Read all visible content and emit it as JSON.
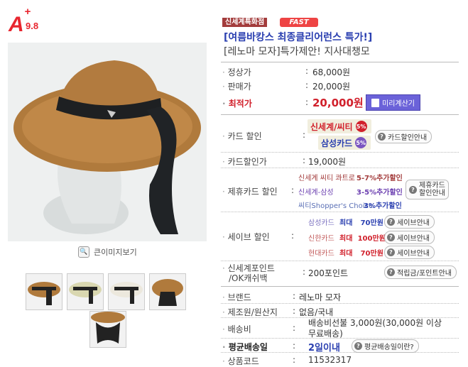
{
  "rating": {
    "grade": "A",
    "plus": "+",
    "score": "9.8"
  },
  "badges": {
    "sale": "신세계특화점",
    "fast": "FAST"
  },
  "title": {
    "line1": "[여름바캉스 최종클리어런스 특가!]",
    "line2": "[레노마 모자]특가제안! 지사대챙모"
  },
  "prices": {
    "regular_label": "정상가",
    "regular": "68,000원",
    "sale_label": "판매가",
    "sale": "20,000원",
    "best_label": "최적가",
    "best": "20,000원",
    "calc_button": "미리계산기"
  },
  "card_discount": {
    "label": "카드 할인",
    "cards": [
      {
        "name": "신세계/씨티",
        "pct": "5%",
        "color": "#d1202b",
        "text_color": "#d1202b"
      },
      {
        "name": "삼성카드",
        "pct": "5%",
        "color": "#7a55c0",
        "text_color": "#2a3fb0"
      }
    ],
    "info_button": "카드할인안내"
  },
  "card_price": {
    "label": "카드할인가",
    "value": "19,000원"
  },
  "partner": {
    "label": "제휴카드 할인",
    "items": [
      {
        "name": "신세계 씨티 콰트로",
        "rate": "5-7%추가할인",
        "color": "#a33c3c"
      },
      {
        "name": "신세계-삼성",
        "rate": "3-5%추가할인",
        "color": "#6b3fb0"
      },
      {
        "name": "씨티Shopper's Choice",
        "rate": "3%추가할인",
        "color": "#5a6fb5"
      }
    ],
    "info_button": "제휴카드\n할인안내"
  },
  "save": {
    "label": "세이브 할인",
    "items": [
      {
        "card": "삼성카드",
        "max": "최대",
        "amount": "70만원",
        "button": "세이브안내",
        "color": "#2a3fb0"
      },
      {
        "card": "신한카드",
        "max": "최대",
        "amount": "100만원",
        "button": "세이브안내",
        "color": "#d1202b"
      },
      {
        "card": "현대카드",
        "max": "최대",
        "amount": "70만원",
        "button": "세이브안내",
        "color": "#d1202b"
      }
    ]
  },
  "points": {
    "label_line1": "신세계포인트",
    "label_line2": "/OK캐쉬백",
    "value": "200포인트",
    "button": "적립금/포인트안내"
  },
  "info": {
    "brand_label": "브랜드",
    "brand": "레노마 모자",
    "maker_label": "제조원/원산지",
    "maker": "없음/국내",
    "ship_label": "배송비",
    "ship_line1": "배송비선불 3,000원(30,000원 이상",
    "ship_line2": "무료배송)",
    "avg_label": "평균배송일",
    "avg": "2일이내",
    "avg_button": "평균배송일이란?",
    "code_label": "상품코드",
    "code": "11532317"
  },
  "zoom_label": "큰이미지보기",
  "thumbnails": [
    "thumb-1",
    "thumb-2",
    "thumb-3",
    "thumb-4",
    "thumb-5"
  ]
}
